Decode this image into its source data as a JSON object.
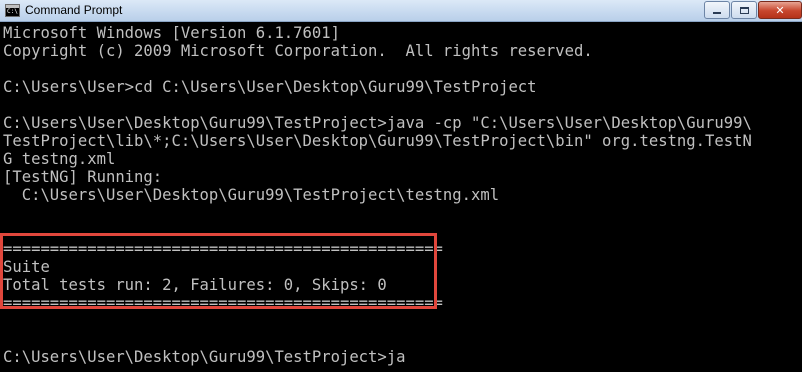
{
  "window": {
    "title": "Command Prompt",
    "controls": {
      "minimize": "minimize",
      "maximize": "maximize",
      "close": "✕"
    }
  },
  "console": {
    "lines": [
      "Microsoft Windows [Version 6.1.7601]",
      "Copyright (c) 2009 Microsoft Corporation.  All rights reserved.",
      "",
      "C:\\Users\\User>cd C:\\Users\\User\\Desktop\\Guru99\\TestProject",
      "",
      "C:\\Users\\User\\Desktop\\Guru99\\TestProject>java -cp \"C:\\Users\\User\\Desktop\\Guru99\\",
      "TestProject\\lib\\*;C:\\Users\\User\\Desktop\\Guru99\\TestProject\\bin\" org.testng.TestN",
      "G testng.xml",
      "[TestNG] Running:",
      "  C:\\Users\\User\\Desktop\\Guru99\\TestProject\\testng.xml",
      "",
      "",
      "===============================================",
      "Suite",
      "Total tests run: 2, Failures: 0, Skips: 0",
      "===============================================",
      "",
      "",
      "C:\\Users\\User\\Desktop\\Guru99\\TestProject>ja"
    ]
  },
  "colors": {
    "background": "#000000",
    "text": "#c0c0c0",
    "highlight_border": "#e0473c"
  }
}
